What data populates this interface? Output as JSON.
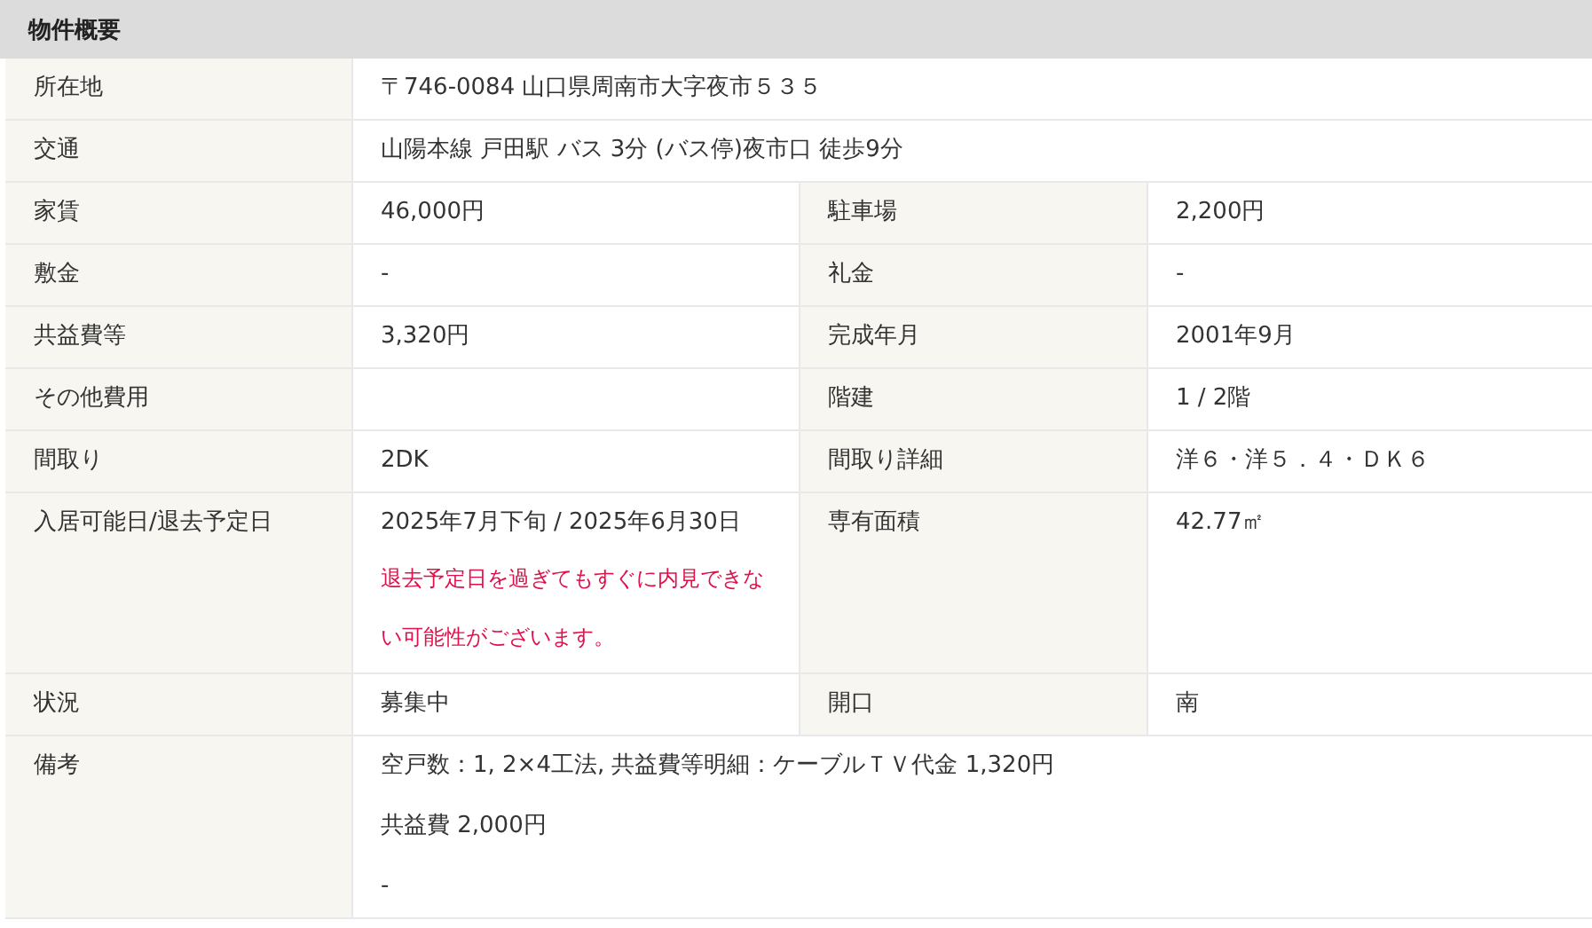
{
  "section": {
    "title": "物件概要"
  },
  "rows": [
    {
      "kind": "full",
      "cells": [
        {
          "label": "所在地",
          "lines": [
            {
              "kind": "text",
              "text": "〒746-0084 山口県周南市大字夜市５３５"
            }
          ]
        }
      ]
    },
    {
      "kind": "full",
      "cells": [
        {
          "label": "交通",
          "lines": [
            {
              "kind": "text",
              "text": "山陽本線 戸田駅 バス 3分 (バス停)夜市口 徒歩9分"
            }
          ]
        }
      ]
    },
    {
      "kind": "pair",
      "cells": [
        {
          "label": "家賃",
          "lines": [
            {
              "kind": "text",
              "text": "46,000円"
            }
          ]
        },
        {
          "label": "駐車場",
          "lines": [
            {
              "kind": "text",
              "text": "2,200円"
            }
          ]
        }
      ]
    },
    {
      "kind": "pair",
      "cells": [
        {
          "label": "敷金",
          "lines": [
            {
              "kind": "text",
              "text": "-"
            }
          ]
        },
        {
          "label": "礼金",
          "lines": [
            {
              "kind": "text",
              "text": "-"
            }
          ]
        }
      ]
    },
    {
      "kind": "pair",
      "cells": [
        {
          "label": "共益費等",
          "lines": [
            {
              "kind": "text",
              "text": "3,320円"
            }
          ]
        },
        {
          "label": "完成年月",
          "lines": [
            {
              "kind": "text",
              "text": "2001年9月"
            }
          ]
        }
      ]
    },
    {
      "kind": "pair",
      "cells": [
        {
          "label": "その他費用"
        },
        {
          "label": "階建",
          "lines": [
            {
              "kind": "text",
              "text": "1 / 2階"
            }
          ]
        }
      ]
    },
    {
      "kind": "pair",
      "cells": [
        {
          "label": "間取り",
          "lines": [
            {
              "kind": "text",
              "text": "2DK"
            }
          ]
        },
        {
          "label": "間取り詳細",
          "lines": [
            {
              "kind": "text",
              "text": "洋６・洋５．４・ＤＫ６"
            }
          ]
        }
      ]
    },
    {
      "kind": "pair",
      "cells": [
        {
          "label": "入居可能日/退去予定日",
          "lines": [
            {
              "kind": "text",
              "text": "2025年7月下旬 / 2025年6月30日"
            },
            {
              "kind": "note",
              "text": "退去予定日を過ぎてもすぐに内見できない可能性がございます。"
            }
          ]
        },
        {
          "label": "専有面積",
          "lines": [
            {
              "kind": "text",
              "text": "42.77㎡"
            }
          ]
        }
      ]
    },
    {
      "kind": "pair",
      "cells": [
        {
          "label": "状況",
          "lines": [
            {
              "kind": "text",
              "text": "募集中"
            }
          ]
        },
        {
          "label": "開口",
          "lines": [
            {
              "kind": "text",
              "text": "南"
            }
          ]
        }
      ]
    },
    {
      "kind": "full",
      "cells": [
        {
          "label": "備考",
          "lines": [
            {
              "kind": "text",
              "text": "空戸数：1, 2×4工法, 共益費等明細：ケーブルＴＶ代金 1,320円"
            },
            {
              "kind": "text",
              "text": "共益費 2,000円"
            },
            {
              "kind": "text",
              "text": "-"
            }
          ]
        }
      ]
    }
  ]
}
